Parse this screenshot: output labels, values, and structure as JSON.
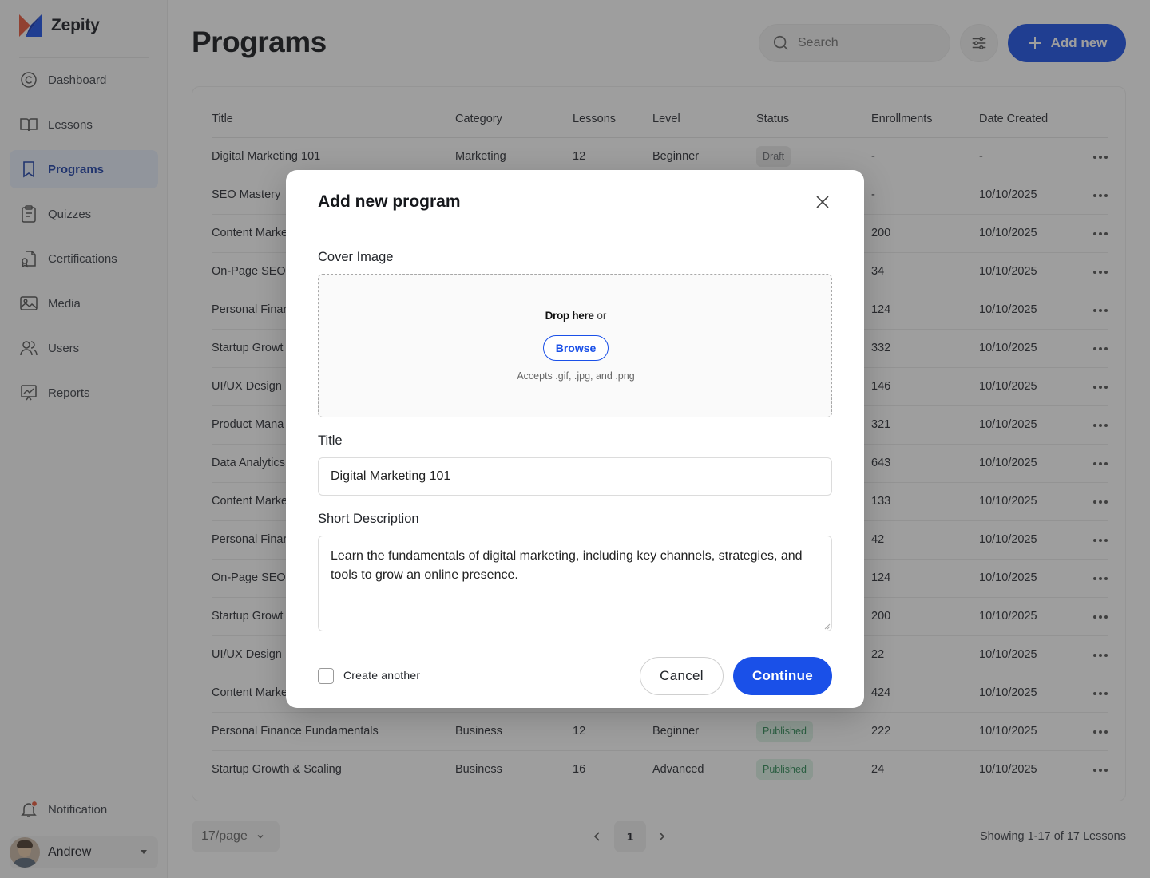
{
  "app": {
    "name": "Zepity"
  },
  "sidebar": {
    "items": [
      {
        "label": "Dashboard",
        "icon": "dashboard-icon"
      },
      {
        "label": "Lessons",
        "icon": "book-icon"
      },
      {
        "label": "Programs",
        "icon": "bookmark-icon",
        "active": true
      },
      {
        "label": "Quizzes",
        "icon": "clipboard-icon"
      },
      {
        "label": "Certifications",
        "icon": "certificate-icon"
      },
      {
        "label": "Media",
        "icon": "image-icon"
      },
      {
        "label": "Users",
        "icon": "users-icon"
      },
      {
        "label": "Reports",
        "icon": "chart-icon"
      }
    ],
    "notification": "Notification",
    "user": "Andrew"
  },
  "header": {
    "title": "Programs",
    "search_placeholder": "Search",
    "add_label": "Add new"
  },
  "table": {
    "columns": [
      "Title",
      "Category",
      "Lessons",
      "Level",
      "Status",
      "Enrollments",
      "Date Created"
    ],
    "rows": [
      {
        "title": "Digital Marketing 101",
        "category": "Marketing",
        "lessons": "12",
        "level": "Beginner",
        "status": "Draft",
        "enrollments": "-",
        "date": "-"
      },
      {
        "title": "SEO Mastery",
        "category": "",
        "lessons": "",
        "level": "",
        "status": "",
        "enrollments": "-",
        "date": "10/10/2025"
      },
      {
        "title": "Content Marke",
        "category": "",
        "lessons": "",
        "level": "",
        "status": "",
        "enrollments": "200",
        "date": "10/10/2025"
      },
      {
        "title": "On-Page SEO",
        "category": "",
        "lessons": "",
        "level": "",
        "status": "",
        "enrollments": "34",
        "date": "10/10/2025"
      },
      {
        "title": "Personal Finar",
        "category": "",
        "lessons": "",
        "level": "",
        "status": "",
        "enrollments": "124",
        "date": "10/10/2025"
      },
      {
        "title": "Startup Growt",
        "category": "",
        "lessons": "",
        "level": "",
        "status": "",
        "enrollments": "332",
        "date": "10/10/2025"
      },
      {
        "title": "UI/UX Design I",
        "category": "",
        "lessons": "",
        "level": "",
        "status": "",
        "enrollments": "146",
        "date": "10/10/2025"
      },
      {
        "title": "Product Mana",
        "category": "",
        "lessons": "",
        "level": "",
        "status": "",
        "enrollments": "321",
        "date": "10/10/2025"
      },
      {
        "title": "Data Analytics",
        "category": "",
        "lessons": "",
        "level": "",
        "status": "",
        "enrollments": "643",
        "date": "10/10/2025"
      },
      {
        "title": "Content Marke",
        "category": "",
        "lessons": "",
        "level": "",
        "status": "",
        "enrollments": "133",
        "date": "10/10/2025"
      },
      {
        "title": "Personal Finar",
        "category": "",
        "lessons": "",
        "level": "",
        "status": "",
        "enrollments": "42",
        "date": "10/10/2025"
      },
      {
        "title": "On-Page SEO",
        "category": "",
        "lessons": "",
        "level": "",
        "status": "",
        "enrollments": "124",
        "date": "10/10/2025"
      },
      {
        "title": "Startup Growt",
        "category": "",
        "lessons": "",
        "level": "",
        "status": "",
        "enrollments": "200",
        "date": "10/10/2025"
      },
      {
        "title": "UI/UX Design I",
        "category": "",
        "lessons": "",
        "level": "",
        "status": "",
        "enrollments": "22",
        "date": "10/10/2025"
      },
      {
        "title": "Content Marke",
        "category": "",
        "lessons": "",
        "level": "",
        "status": "",
        "enrollments": "424",
        "date": "10/10/2025"
      },
      {
        "title": "Personal Finance Fundamentals",
        "category": "Business",
        "lessons": "12",
        "level": "Beginner",
        "status": "Published",
        "enrollments": "222",
        "date": "10/10/2025"
      },
      {
        "title": "Startup Growth & Scaling",
        "category": "Business",
        "lessons": "16",
        "level": "Advanced",
        "status": "Published",
        "enrollments": "24",
        "date": "10/10/2025"
      }
    ]
  },
  "footer": {
    "per_page": "17/page",
    "page": "1",
    "showing": "Showing 1-17 of 17 Lessons"
  },
  "modal": {
    "title": "Add new program",
    "cover_label": "Cover Image",
    "drop_bold": "Drop here",
    "drop_rest": " or",
    "browse": "Browse",
    "accepts": "Accepts .gif, .jpg, and .png",
    "title_label": "Title",
    "title_value": "Digital Marketing 101",
    "desc_label": "Short Description",
    "desc_value": "Learn the fundamentals of digital marketing, including key channels, strategies, and tools to grow an online presence.",
    "create_another": "Create another",
    "cancel": "Cancel",
    "continue": "Continue"
  },
  "colors": {
    "primary": "#1a50e8",
    "published": "#2e8b57",
    "draft": "#6b6e74",
    "notification_dot": "#e8563a"
  }
}
